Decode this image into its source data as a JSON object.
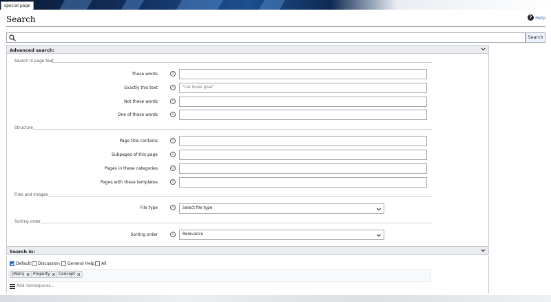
{
  "tab": {
    "label": "special page"
  },
  "page": {
    "title": "Search",
    "help_label": "Help"
  },
  "search": {
    "value": "",
    "button_label": "Search"
  },
  "advanced": {
    "header": "Advanced search:",
    "groups": [
      {
        "legend": "Search in page text",
        "fields": [
          {
            "label": "These words",
            "value": "",
            "placeholder": ""
          },
          {
            "label": "Exactly this text",
            "value": "",
            "placeholder": "\"cat loves goat\""
          },
          {
            "label": "Not these words",
            "value": "",
            "placeholder": ""
          },
          {
            "label": "One of these words",
            "value": "",
            "placeholder": ""
          }
        ]
      },
      {
        "legend": "Structure",
        "fields": [
          {
            "label": "Page title contains",
            "value": "",
            "placeholder": ""
          },
          {
            "label": "Subpages of this page",
            "value": "",
            "placeholder": ""
          },
          {
            "label": "Pages in these categories",
            "value": "",
            "placeholder": ""
          },
          {
            "label": "Pages with these templates",
            "value": "",
            "placeholder": ""
          }
        ]
      },
      {
        "legend": "Files and images",
        "fields": [
          {
            "label": "File type",
            "selected": "Select file type"
          }
        ]
      },
      {
        "legend": "Sorting order",
        "fields": [
          {
            "label": "Sorting order",
            "selected": "Relevance"
          }
        ]
      }
    ]
  },
  "search_in": {
    "header": "Search in:",
    "checkboxes": [
      {
        "label": "Default",
        "checked": true
      },
      {
        "label": "Discussion",
        "checked": false
      },
      {
        "label": "General Help",
        "checked": false
      },
      {
        "label": "All",
        "checked": false
      }
    ],
    "namespaces": [
      "(Main)",
      "Property",
      "Concept"
    ],
    "add_placeholder": "Add namespaces..."
  },
  "icons": {
    "info": "info-icon",
    "help": "help-icon",
    "search": "magnifier-icon",
    "chevron": "chevron-down-icon",
    "remove": "remove-x-icon",
    "menu": "menu-icon"
  },
  "colors": {
    "accent": "#3366cc",
    "button_bg": "#eaf3ff",
    "header_bg": "#eaecf0",
    "border": "#a2a9b1"
  }
}
